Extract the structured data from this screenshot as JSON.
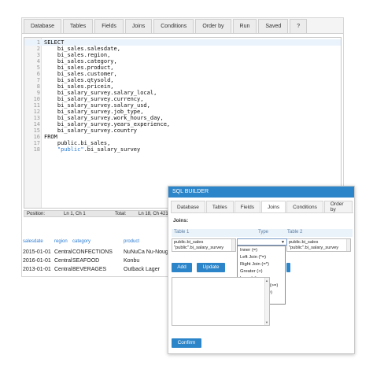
{
  "main_tabs": [
    "Database",
    "Tables",
    "Fields",
    "Joins",
    "Conditions",
    "Order by",
    "Run",
    "Saved",
    "?"
  ],
  "editor": {
    "lines": [
      {
        "n": "1",
        "text": "SELECT",
        "kind": "kw"
      },
      {
        "n": "2",
        "text": "    bi_sales.salesdate,",
        "kind": "plain"
      },
      {
        "n": "3",
        "text": "    bi_sales.region,",
        "kind": "plain"
      },
      {
        "n": "4",
        "text": "    bi_sales.category,",
        "kind": "plain"
      },
      {
        "n": "5",
        "text": "    bi_sales.product,",
        "kind": "plain"
      },
      {
        "n": "6",
        "text": "    bi_sales.customer,",
        "kind": "plain"
      },
      {
        "n": "7",
        "text": "    bi_sales.qtysold,",
        "kind": "plain"
      },
      {
        "n": "8",
        "text": "    bi_sales.pricein,",
        "kind": "plain"
      },
      {
        "n": "9",
        "text": "    bi_salary_survey.salary_local,",
        "kind": "plain"
      },
      {
        "n": "10",
        "text": "    bi_salary_survey.currency,",
        "kind": "plain"
      },
      {
        "n": "11",
        "text": "    bi_salary_survey.salary_usd,",
        "kind": "plain"
      },
      {
        "n": "12",
        "text": "    bi_salary_survey.job_type,",
        "kind": "plain"
      },
      {
        "n": "13",
        "text": "    bi_salary_survey.work_hours_day,",
        "kind": "plain"
      },
      {
        "n": "14",
        "text": "    bi_salary_survey.years_experience,",
        "kind": "plain"
      },
      {
        "n": "15",
        "text": "    bi_salary_survey.country",
        "kind": "plain"
      },
      {
        "n": "16",
        "text": "FROM",
        "kind": "kw"
      },
      {
        "n": "17",
        "text": "    public.bi_sales,",
        "kind": "plain"
      },
      {
        "n": "18",
        "text": "    \"public\".bi_salary_survey",
        "kind": "mixed",
        "str_part": "\"public\"",
        "rest": ".bi_salary_survey"
      }
    ]
  },
  "status": {
    "position_label": "Position:",
    "position_value": "Ln 1, Ch 1",
    "total_label": "Total:",
    "total_value": "Ln 18, Ch 421"
  },
  "results": {
    "headers": [
      "salesdate",
      "region",
      "category",
      "product"
    ],
    "rows": [
      [
        "2015-01-01",
        "Central",
        "CONFECTIONS",
        "NuNuCa Nu-Nouga"
      ],
      [
        "2016-01-01",
        "Central",
        "SEAFOOD",
        "Konbu"
      ],
      [
        "2013-01-01",
        "Central",
        "BEVERAGES",
        "Outback Lager"
      ]
    ]
  },
  "builder": {
    "title": "SQL BUILDER",
    "tabs": [
      "Database",
      "Tables",
      "Fields",
      "Joins",
      "Conditions",
      "Order by"
    ],
    "active_tab": "Joins",
    "joins_label": "Joins:",
    "col_table1": "Table 1",
    "col_type": "Type",
    "col_table2": "Table 2",
    "table1_items": [
      "public.bi_sales",
      "\"public\".bi_salary_survey"
    ],
    "table2_items": [
      "public.bi_sales",
      "\"public\".bi_salary_survey"
    ],
    "type_options": [
      "Inner (=)",
      "Left Join (*=)",
      "Right Join (=*)",
      "Greater (>)",
      "Less (<)",
      "Greater Equal (>=)",
      "Less Equal (<=)",
      "Not Equal (!=)"
    ],
    "add_label": "Add",
    "update_label": "Update",
    "confirm_label": "Confirm"
  },
  "colors": {
    "accent": "#2c85c9",
    "keyword": "#1a6fb0",
    "string": "#2a7bd4"
  }
}
